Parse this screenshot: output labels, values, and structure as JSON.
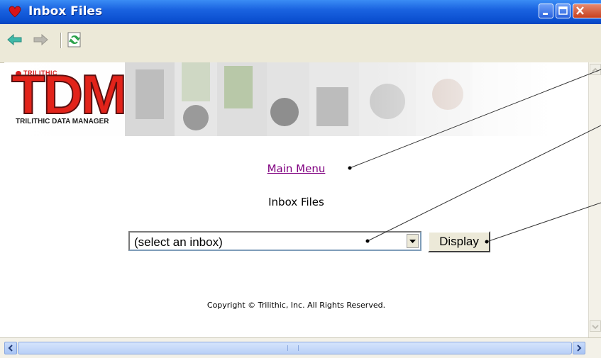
{
  "window": {
    "title": "Inbox Files",
    "icons": {
      "app": "heart-icon",
      "minimize": "minimize-icon",
      "maximize": "maximize-icon",
      "close": "close-icon"
    }
  },
  "toolbar": {
    "icons": [
      "back-arrow-icon",
      "forward-arrow-icon",
      "refresh-icon"
    ]
  },
  "banner": {
    "brand_small": "TRILITHIC",
    "logo": "TDM",
    "subtitle": "TRILITHIC DATA MANAGER"
  },
  "page": {
    "main_menu_link": "Main Menu",
    "heading": "Inbox Files",
    "inbox_select": {
      "selected": "(select an inbox)"
    },
    "display_button": "Display",
    "copyright": "Copyright © Trilithic, Inc. All Rights Reserved."
  },
  "colors": {
    "titlebar": "#0b4fd0",
    "link_visited": "#800080",
    "logo_red": "#e2231a",
    "window_chrome": "#ece9d8"
  }
}
